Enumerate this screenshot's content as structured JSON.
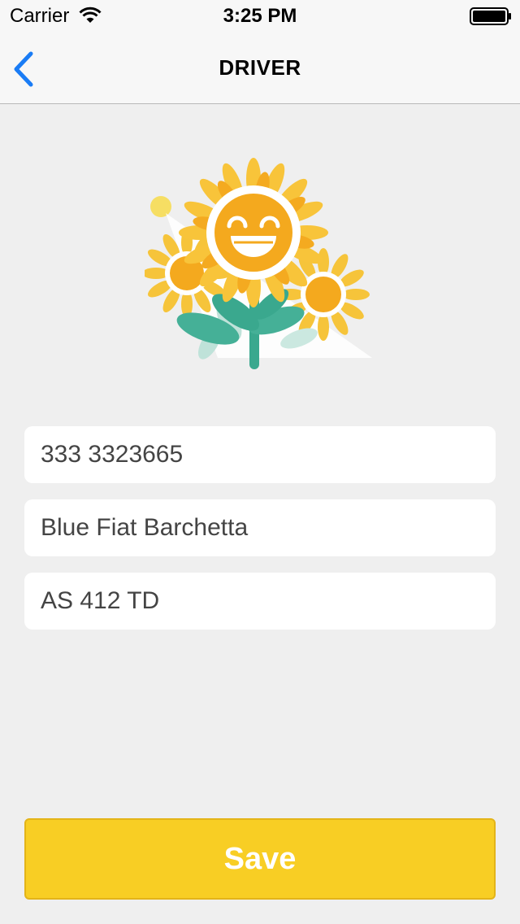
{
  "status_bar": {
    "carrier": "Carrier",
    "time": "3:25 PM"
  },
  "nav": {
    "title": "DRIVER",
    "back_icon": "chevron-left-icon",
    "accent_color": "#1a7cf5"
  },
  "illustration": {
    "icon": "smiling-sunflower-icon"
  },
  "form": {
    "phone_value": "333 3323665",
    "car_value": "Blue Fiat Barchetta",
    "plate_value": "AS 412 TD"
  },
  "actions": {
    "save_label": "Save",
    "save_color": "#f8ce24"
  }
}
